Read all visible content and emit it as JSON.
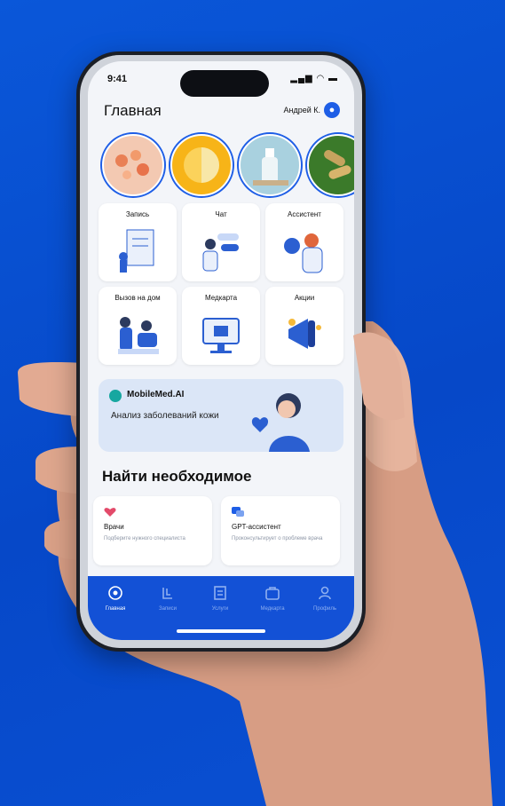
{
  "status": {
    "time": "9:41",
    "icons": "▂▄▆ ◠ ▬"
  },
  "header": {
    "title": "Главная",
    "user": "Андрей К."
  },
  "stories": [
    {
      "name": "story-flowers"
    },
    {
      "name": "story-orange"
    },
    {
      "name": "story-bottle"
    },
    {
      "name": "story-capsules"
    }
  ],
  "services": [
    {
      "label": "Запись"
    },
    {
      "label": "Чат"
    },
    {
      "label": "Ассистент"
    },
    {
      "label": "Вызов на дом"
    },
    {
      "label": "Медкарта"
    },
    {
      "label": "Акции"
    }
  ],
  "banner": {
    "brand": "MobileMed.AI",
    "text": "Анализ заболеваний кожи"
  },
  "find": {
    "title": "Найти необходимое",
    "cards": [
      {
        "title": "Врачи",
        "subtitle": "Подберите нужного специалиста",
        "icon": "heart-icon"
      },
      {
        "title": "GPT-ассистент",
        "subtitle": "Проконсультирует о проблеме врача",
        "icon": "chat-icon"
      }
    ]
  },
  "tabs": [
    {
      "label": "Главная",
      "icon": "home-icon",
      "active": true
    },
    {
      "label": "Записи",
      "icon": "records-icon",
      "active": false
    },
    {
      "label": "Услуги",
      "icon": "services-icon",
      "active": false
    },
    {
      "label": "Медкарта",
      "icon": "medcard-icon",
      "active": false
    },
    {
      "label": "Профиль",
      "icon": "profile-icon",
      "active": false
    }
  ],
  "colors": {
    "background": "#0648c8",
    "accent": "#1e5ee6",
    "tabbar": "#1351d6",
    "screen": "#f3f5f9"
  }
}
